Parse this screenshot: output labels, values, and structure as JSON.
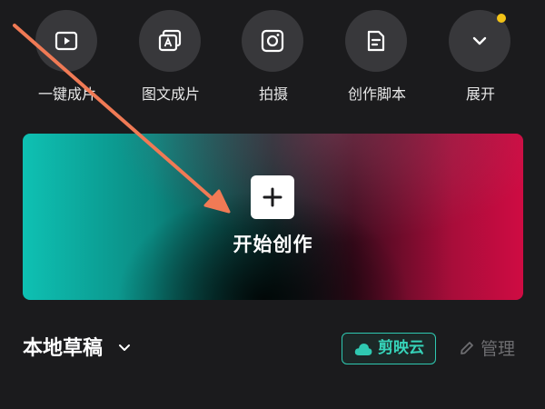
{
  "toolbar": {
    "items": [
      {
        "label": "一键成片",
        "icon": "play-icon"
      },
      {
        "label": "图文成片",
        "icon": "image-text-icon"
      },
      {
        "label": "拍摄",
        "icon": "camera-icon"
      },
      {
        "label": "创作脚本",
        "icon": "script-icon"
      },
      {
        "label": "展开",
        "icon": "chevron-down-icon"
      }
    ]
  },
  "banner": {
    "label": "开始创作",
    "icon": "plus-icon"
  },
  "drafts": {
    "title": "本地草稿",
    "cloud_label": "剪映云",
    "manage_label": "管理"
  },
  "colors": {
    "accent": "#2fc9b1",
    "arrow": "#f07a55",
    "badge": "#f3c317"
  }
}
